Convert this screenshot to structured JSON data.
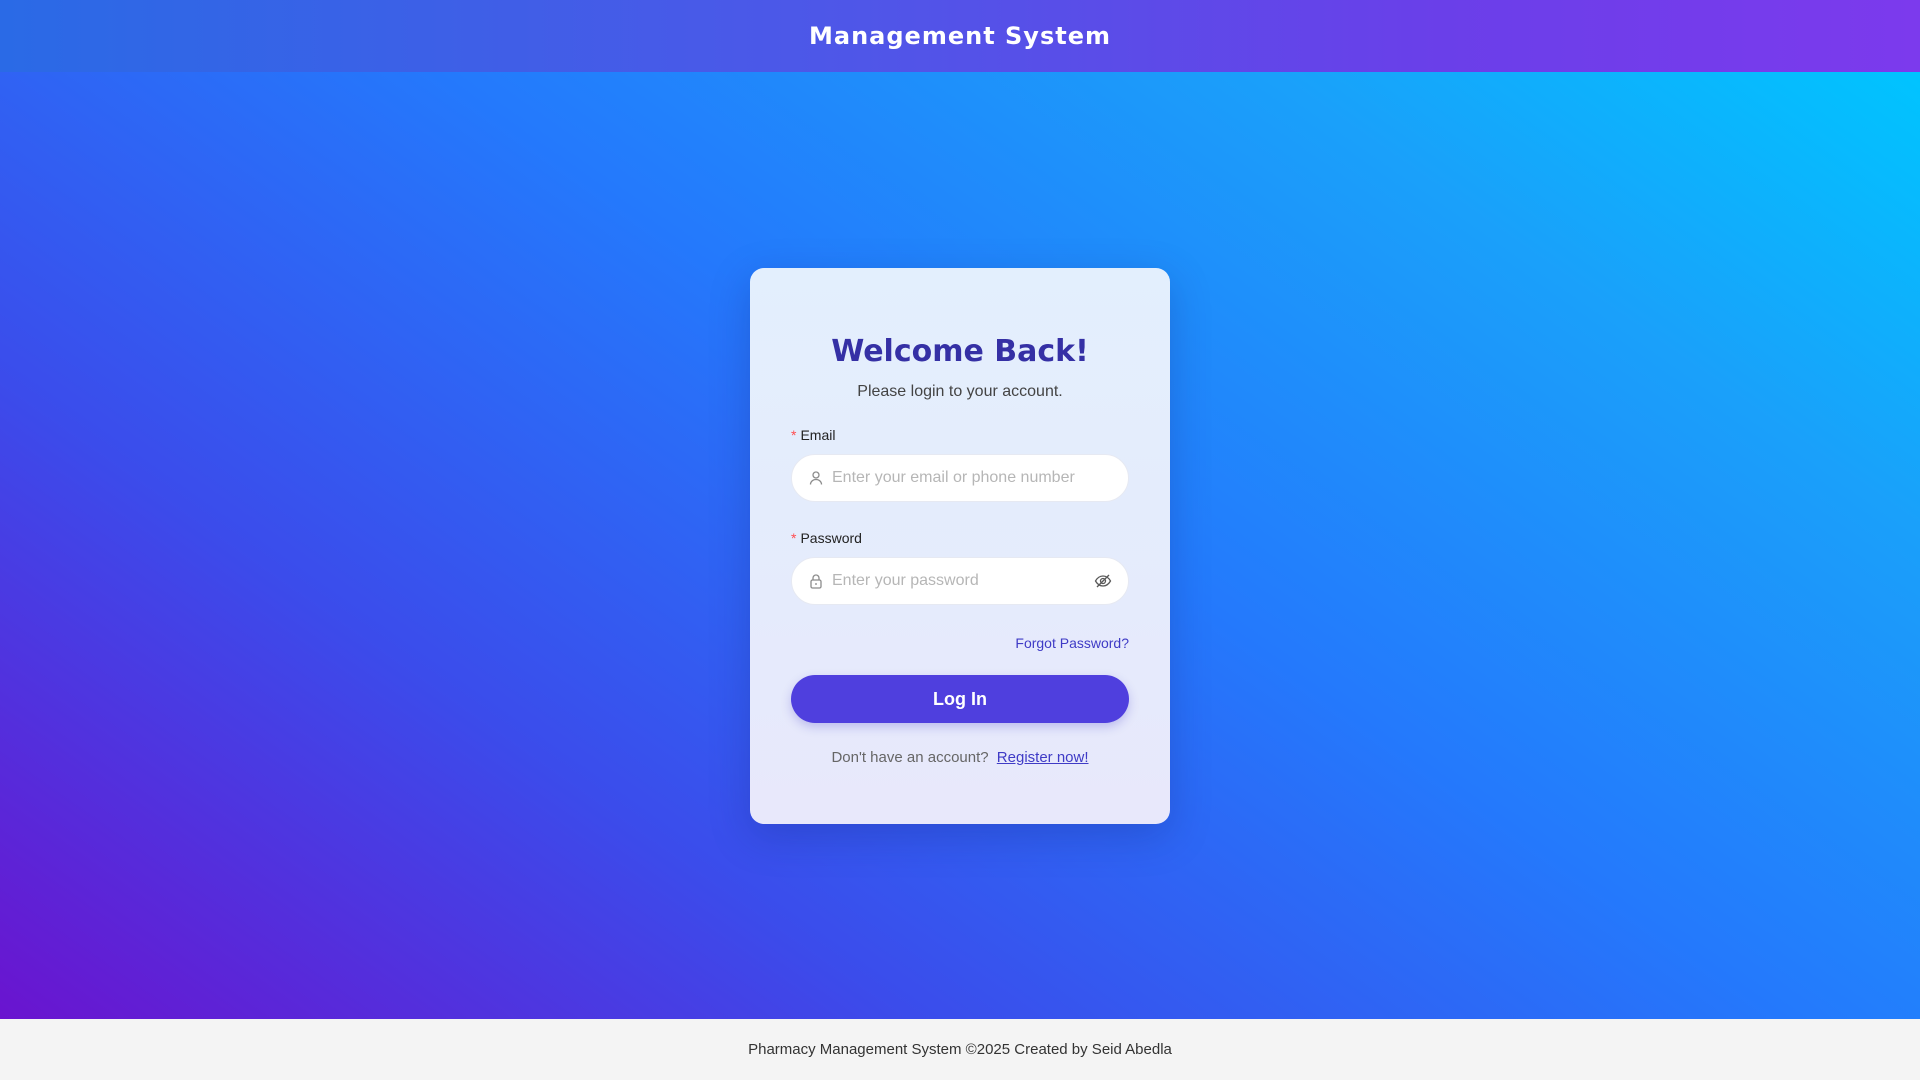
{
  "header": {
    "title": "Management System"
  },
  "login": {
    "title": "Welcome Back!",
    "subtitle": "Please login to your account.",
    "email": {
      "required_mark": "*",
      "label": "Email",
      "placeholder": "Enter your email or phone number",
      "icon": "user-icon"
    },
    "password": {
      "required_mark": "*",
      "label": "Password",
      "placeholder": "Enter your password",
      "icon": "lock-icon",
      "toggle_icon": "eye-hidden-icon"
    },
    "forgot_password": "Forgot Password?",
    "submit_label": "Log In",
    "register_prompt": "Don't have an account?",
    "register_link": "Register now!"
  },
  "footer": {
    "text": "Pharmacy Management System ©2025 Created by Seid Abedla"
  },
  "colors": {
    "primary": "#4f3fde",
    "title": "#3530a5",
    "link": "#3f3bc6",
    "required": "#ff4d4f"
  }
}
